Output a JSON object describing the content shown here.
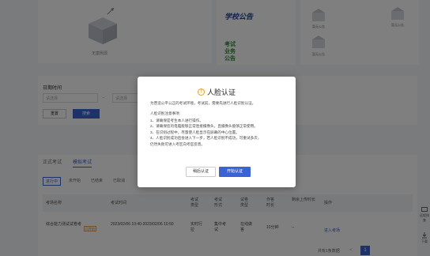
{
  "top": {
    "empty_text": "无案例源",
    "notice_title": "学校公告",
    "exam_title": "考试业务公告",
    "side_items": [
      "暂无公告",
      "暂无公告",
      "暂无公告"
    ]
  },
  "filter": {
    "date_label": "日期时间",
    "start_placeholder": "请选择",
    "end_placeholder": "请选择",
    "separator": "-",
    "reset_label": "重置",
    "search_label": "搜索"
  },
  "tabs": [
    "正式考试",
    "模拟考试"
  ],
  "subtabs": [
    "进行中",
    "未开始",
    "已结束",
    "已取消"
  ],
  "table": {
    "headers": [
      "考场名称",
      "考试时间",
      "考试类型",
      "考试形式",
      "试卷类型",
      "作答时长",
      "剩余上传时长",
      "操作"
    ],
    "row": {
      "name": "综合能力测试试卷考",
      "badge": "已开启",
      "time": "2023/02/06 10:40-2023/02/06 10:50",
      "type": "实时行拉",
      "form": "集中考试",
      "paper": "在线做答",
      "duration": "10分钟",
      "remaining": "--",
      "action": "进入考场"
    }
  },
  "pager": {
    "total": "共有1条数据",
    "prev": "<",
    "page": "1"
  },
  "right_tools": [
    "远程排查",
    "下载"
  ],
  "modal": {
    "icon": "!",
    "title": "人脸认证",
    "intro": "为营造公平公正的考试环境，考试前，需要先进行人脸识别认证。",
    "sub": "人脸识别注意事项:",
    "rules": [
      "1、请确保是考生本人进行操作。",
      "2、请确保您的电脑能够正常连接摄像头，且摄像头能够正常使用。",
      "3、在识别过程中，尽量使人脸显示在屏幕的中心位置。",
      "4、人脸识别成功后会进入下一步，若人脸识别不成功，可重试多次，",
      "仍然失败可进入考区向考官反馈。"
    ],
    "cancel_label": "稍后认证",
    "start_label": "开始认证"
  }
}
